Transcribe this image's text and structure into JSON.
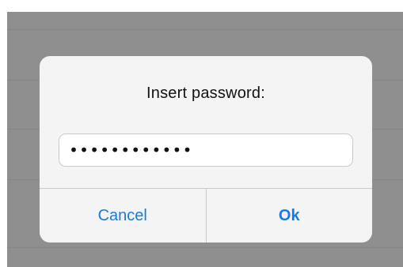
{
  "dialog": {
    "title": "Insert password:",
    "password_value": "••••••••••••",
    "cancel_label": "Cancel",
    "ok_label": "Ok"
  },
  "colors": {
    "backdrop": "#8f8f8f",
    "dialog_background": "#f4f4f4",
    "button_text": "#1a78e8",
    "title_text": "#111111"
  }
}
